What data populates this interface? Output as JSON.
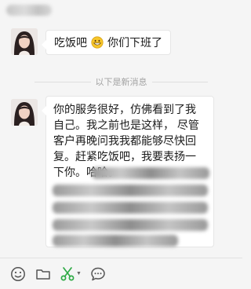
{
  "messages": [
    {
      "text_before": "吃饭吧",
      "emoji": "grinning-face",
      "text_after": "你们下班了"
    },
    {
      "text": "你的服务很好，仿佛看到了我自己。我之前也是这样， 尽管 客户再晚问我我都能够尽快回复。赶紧吃饭吧，我要表扬一下你。哈哈。"
    }
  ],
  "divider": {
    "label": "以下是新消息"
  },
  "toolbar": {
    "icons": [
      "smiley-icon",
      "folder-icon",
      "scissors-icon",
      "chat-bubble-icon"
    ]
  },
  "colors": {
    "background": "#f5f5f5",
    "bubble": "#ffffff",
    "scissors": "#2eaa45"
  }
}
